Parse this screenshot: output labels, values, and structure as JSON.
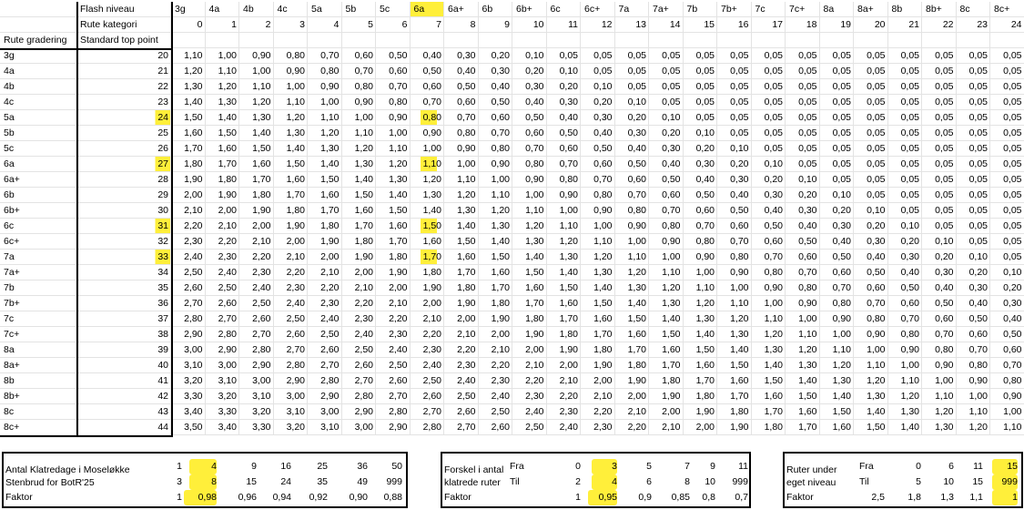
{
  "header": {
    "flash_label": "Flash niveau",
    "rute_kategori_label": "Rute kategori",
    "rute_gradering_label": "Rute gradering",
    "standard_top_label": "Standard top point",
    "grade_headers": [
      "3g",
      "4a",
      "4b",
      "4c",
      "5a",
      "5b",
      "5c",
      "6a",
      "6a+",
      "6b",
      "6b+",
      "6c",
      "6c+",
      "7a",
      "7a+",
      "7b",
      "7b+",
      "7c",
      "7c+",
      "8a",
      "8a+",
      "8b",
      "8b+",
      "8c",
      "8c+"
    ],
    "category_numbers": [
      "0",
      "1",
      "2",
      "3",
      "4",
      "5",
      "6",
      "7",
      "8",
      "9",
      "10",
      "11",
      "12",
      "13",
      "14",
      "15",
      "16",
      "17",
      "18",
      "19",
      "20",
      "21",
      "22",
      "23",
      "24"
    ]
  },
  "rows": [
    {
      "grade": "3g",
      "points": "20",
      "values": [
        "1,10",
        "1,00",
        "0,90",
        "0,80",
        "0,70",
        "0,60",
        "0,50",
        "0,40",
        "0,30",
        "0,20",
        "0,10",
        "0,05",
        "0,05",
        "0,05",
        "0,05",
        "0,05",
        "0,05",
        "0,05",
        "0,05",
        "0,05",
        "0,05",
        "0,05",
        "0,05",
        "0,05",
        "0,05"
      ]
    },
    {
      "grade": "4a",
      "points": "21",
      "values": [
        "1,20",
        "1,10",
        "1,00",
        "0,90",
        "0,80",
        "0,70",
        "0,60",
        "0,50",
        "0,40",
        "0,30",
        "0,20",
        "0,10",
        "0,05",
        "0,05",
        "0,05",
        "0,05",
        "0,05",
        "0,05",
        "0,05",
        "0,05",
        "0,05",
        "0,05",
        "0,05",
        "0,05",
        "0,05"
      ]
    },
    {
      "grade": "4b",
      "points": "22",
      "values": [
        "1,30",
        "1,20",
        "1,10",
        "1,00",
        "0,90",
        "0,80",
        "0,70",
        "0,60",
        "0,50",
        "0,40",
        "0,30",
        "0,20",
        "0,10",
        "0,05",
        "0,05",
        "0,05",
        "0,05",
        "0,05",
        "0,05",
        "0,05",
        "0,05",
        "0,05",
        "0,05",
        "0,05",
        "0,05"
      ]
    },
    {
      "grade": "4c",
      "points": "23",
      "values": [
        "1,40",
        "1,30",
        "1,20",
        "1,10",
        "1,00",
        "0,90",
        "0,80",
        "0,70",
        "0,60",
        "0,50",
        "0,40",
        "0,30",
        "0,20",
        "0,10",
        "0,05",
        "0,05",
        "0,05",
        "0,05",
        "0,05",
        "0,05",
        "0,05",
        "0,05",
        "0,05",
        "0,05",
        "0,05"
      ]
    },
    {
      "grade": "5a",
      "points": "24",
      "values": [
        "1,50",
        "1,40",
        "1,30",
        "1,20",
        "1,10",
        "1,00",
        "0,90",
        "0,80",
        "0,70",
        "0,60",
        "0,50",
        "0,40",
        "0,30",
        "0,20",
        "0,10",
        "0,05",
        "0,05",
        "0,05",
        "0,05",
        "0,05",
        "0,05",
        "0,05",
        "0,05",
        "0,05",
        "0,05"
      ]
    },
    {
      "grade": "5b",
      "points": "25",
      "values": [
        "1,60",
        "1,50",
        "1,40",
        "1,30",
        "1,20",
        "1,10",
        "1,00",
        "0,90",
        "0,80",
        "0,70",
        "0,60",
        "0,50",
        "0,40",
        "0,30",
        "0,20",
        "0,10",
        "0,05",
        "0,05",
        "0,05",
        "0,05",
        "0,05",
        "0,05",
        "0,05",
        "0,05",
        "0,05"
      ]
    },
    {
      "grade": "5c",
      "points": "26",
      "values": [
        "1,70",
        "1,60",
        "1,50",
        "1,40",
        "1,30",
        "1,20",
        "1,10",
        "1,00",
        "0,90",
        "0,80",
        "0,70",
        "0,60",
        "0,50",
        "0,40",
        "0,30",
        "0,20",
        "0,10",
        "0,05",
        "0,05",
        "0,05",
        "0,05",
        "0,05",
        "0,05",
        "0,05",
        "0,05"
      ]
    },
    {
      "grade": "6a",
      "points": "27",
      "values": [
        "1,80",
        "1,70",
        "1,60",
        "1,50",
        "1,40",
        "1,30",
        "1,20",
        "1,10",
        "1,00",
        "0,90",
        "0,80",
        "0,70",
        "0,60",
        "0,50",
        "0,40",
        "0,30",
        "0,20",
        "0,10",
        "0,05",
        "0,05",
        "0,05",
        "0,05",
        "0,05",
        "0,05",
        "0,05"
      ]
    },
    {
      "grade": "6a+",
      "points": "28",
      "values": [
        "1,90",
        "1,80",
        "1,70",
        "1,60",
        "1,50",
        "1,40",
        "1,30",
        "1,20",
        "1,10",
        "1,00",
        "0,90",
        "0,80",
        "0,70",
        "0,60",
        "0,50",
        "0,40",
        "0,30",
        "0,20",
        "0,10",
        "0,05",
        "0,05",
        "0,05",
        "0,05",
        "0,05",
        "0,05"
      ]
    },
    {
      "grade": "6b",
      "points": "29",
      "values": [
        "2,00",
        "1,90",
        "1,80",
        "1,70",
        "1,60",
        "1,50",
        "1,40",
        "1,30",
        "1,20",
        "1,10",
        "1,00",
        "0,90",
        "0,80",
        "0,70",
        "0,60",
        "0,50",
        "0,40",
        "0,30",
        "0,20",
        "0,10",
        "0,05",
        "0,05",
        "0,05",
        "0,05",
        "0,05"
      ]
    },
    {
      "grade": "6b+",
      "points": "30",
      "values": [
        "2,10",
        "2,00",
        "1,90",
        "1,80",
        "1,70",
        "1,60",
        "1,50",
        "1,40",
        "1,30",
        "1,20",
        "1,10",
        "1,00",
        "0,90",
        "0,80",
        "0,70",
        "0,60",
        "0,50",
        "0,40",
        "0,30",
        "0,20",
        "0,10",
        "0,05",
        "0,05",
        "0,05",
        "0,05"
      ]
    },
    {
      "grade": "6c",
      "points": "31",
      "values": [
        "2,20",
        "2,10",
        "2,00",
        "1,90",
        "1,80",
        "1,70",
        "1,60",
        "1,50",
        "1,40",
        "1,30",
        "1,20",
        "1,10",
        "1,00",
        "0,90",
        "0,80",
        "0,70",
        "0,60",
        "0,50",
        "0,40",
        "0,30",
        "0,20",
        "0,10",
        "0,05",
        "0,05",
        "0,05"
      ]
    },
    {
      "grade": "6c+",
      "points": "32",
      "values": [
        "2,30",
        "2,20",
        "2,10",
        "2,00",
        "1,90",
        "1,80",
        "1,70",
        "1,60",
        "1,50",
        "1,40",
        "1,30",
        "1,20",
        "1,10",
        "1,00",
        "0,90",
        "0,80",
        "0,70",
        "0,60",
        "0,50",
        "0,40",
        "0,30",
        "0,20",
        "0,10",
        "0,05",
        "0,05"
      ]
    },
    {
      "grade": "7a",
      "points": "33",
      "values": [
        "2,40",
        "2,30",
        "2,20",
        "2,10",
        "2,00",
        "1,90",
        "1,80",
        "1,70",
        "1,60",
        "1,50",
        "1,40",
        "1,30",
        "1,20",
        "1,10",
        "1,00",
        "0,90",
        "0,80",
        "0,70",
        "0,60",
        "0,50",
        "0,40",
        "0,30",
        "0,20",
        "0,10",
        "0,05"
      ]
    },
    {
      "grade": "7a+",
      "points": "34",
      "values": [
        "2,50",
        "2,40",
        "2,30",
        "2,20",
        "2,10",
        "2,00",
        "1,90",
        "1,80",
        "1,70",
        "1,60",
        "1,50",
        "1,40",
        "1,30",
        "1,20",
        "1,10",
        "1,00",
        "0,90",
        "0,80",
        "0,70",
        "0,60",
        "0,50",
        "0,40",
        "0,30",
        "0,20",
        "0,10"
      ]
    },
    {
      "grade": "7b",
      "points": "35",
      "values": [
        "2,60",
        "2,50",
        "2,40",
        "2,30",
        "2,20",
        "2,10",
        "2,00",
        "1,90",
        "1,80",
        "1,70",
        "1,60",
        "1,50",
        "1,40",
        "1,30",
        "1,20",
        "1,10",
        "1,00",
        "0,90",
        "0,80",
        "0,70",
        "0,60",
        "0,50",
        "0,40",
        "0,30",
        "0,20"
      ]
    },
    {
      "grade": "7b+",
      "points": "36",
      "values": [
        "2,70",
        "2,60",
        "2,50",
        "2,40",
        "2,30",
        "2,20",
        "2,10",
        "2,00",
        "1,90",
        "1,80",
        "1,70",
        "1,60",
        "1,50",
        "1,40",
        "1,30",
        "1,20",
        "1,10",
        "1,00",
        "0,90",
        "0,80",
        "0,70",
        "0,60",
        "0,50",
        "0,40",
        "0,30"
      ]
    },
    {
      "grade": "7c",
      "points": "37",
      "values": [
        "2,80",
        "2,70",
        "2,60",
        "2,50",
        "2,40",
        "2,30",
        "2,20",
        "2,10",
        "2,00",
        "1,90",
        "1,80",
        "1,70",
        "1,60",
        "1,50",
        "1,40",
        "1,30",
        "1,20",
        "1,10",
        "1,00",
        "0,90",
        "0,80",
        "0,70",
        "0,60",
        "0,50",
        "0,40"
      ]
    },
    {
      "grade": "7c+",
      "points": "38",
      "values": [
        "2,90",
        "2,80",
        "2,70",
        "2,60",
        "2,50",
        "2,40",
        "2,30",
        "2,20",
        "2,10",
        "2,00",
        "1,90",
        "1,80",
        "1,70",
        "1,60",
        "1,50",
        "1,40",
        "1,30",
        "1,20",
        "1,10",
        "1,00",
        "0,90",
        "0,80",
        "0,70",
        "0,60",
        "0,50"
      ]
    },
    {
      "grade": "8a",
      "points": "39",
      "values": [
        "3,00",
        "2,90",
        "2,80",
        "2,70",
        "2,60",
        "2,50",
        "2,40",
        "2,30",
        "2,20",
        "2,10",
        "2,00",
        "1,90",
        "1,80",
        "1,70",
        "1,60",
        "1,50",
        "1,40",
        "1,30",
        "1,20",
        "1,10",
        "1,00",
        "0,90",
        "0,80",
        "0,70",
        "0,60"
      ]
    },
    {
      "grade": "8a+",
      "points": "40",
      "values": [
        "3,10",
        "3,00",
        "2,90",
        "2,80",
        "2,70",
        "2,60",
        "2,50",
        "2,40",
        "2,30",
        "2,20",
        "2,10",
        "2,00",
        "1,90",
        "1,80",
        "1,70",
        "1,60",
        "1,50",
        "1,40",
        "1,30",
        "1,20",
        "1,10",
        "1,00",
        "0,90",
        "0,80",
        "0,70"
      ]
    },
    {
      "grade": "8b",
      "points": "41",
      "values": [
        "3,20",
        "3,10",
        "3,00",
        "2,90",
        "2,80",
        "2,70",
        "2,60",
        "2,50",
        "2,40",
        "2,30",
        "2,20",
        "2,10",
        "2,00",
        "1,90",
        "1,80",
        "1,70",
        "1,60",
        "1,50",
        "1,40",
        "1,30",
        "1,20",
        "1,10",
        "1,00",
        "0,90",
        "0,80"
      ]
    },
    {
      "grade": "8b+",
      "points": "42",
      "values": [
        "3,30",
        "3,20",
        "3,10",
        "3,00",
        "2,90",
        "2,80",
        "2,70",
        "2,60",
        "2,50",
        "2,40",
        "2,30",
        "2,20",
        "2,10",
        "2,00",
        "1,90",
        "1,80",
        "1,70",
        "1,60",
        "1,50",
        "1,40",
        "1,30",
        "1,20",
        "1,10",
        "1,00",
        "0,90"
      ]
    },
    {
      "grade": "8c",
      "points": "43",
      "values": [
        "3,40",
        "3,30",
        "3,20",
        "3,10",
        "3,00",
        "2,90",
        "2,80",
        "2,70",
        "2,60",
        "2,50",
        "2,40",
        "2,30",
        "2,20",
        "2,10",
        "2,00",
        "1,90",
        "1,80",
        "1,70",
        "1,60",
        "1,50",
        "1,40",
        "1,30",
        "1,20",
        "1,10",
        "1,00"
      ]
    },
    {
      "grade": "8c+",
      "points": "44",
      "values": [
        "3,50",
        "3,40",
        "3,30",
        "3,20",
        "3,10",
        "3,00",
        "2,90",
        "2,80",
        "2,70",
        "2,60",
        "2,50",
        "2,40",
        "2,30",
        "2,20",
        "2,10",
        "2,00",
        "1,90",
        "1,80",
        "1,70",
        "1,60",
        "1,50",
        "1,40",
        "1,30",
        "1,20",
        "1,10"
      ]
    }
  ],
  "highlights": {
    "color": "#ffef3a",
    "grade_header_index": 7,
    "highlighted_points_rows": [
      "5a",
      "6a",
      "6c",
      "7a"
    ],
    "highlighted_value_cells": [
      {
        "row": "5a",
        "col": 7
      },
      {
        "row": "6a",
        "col": 7
      },
      {
        "row": "6c",
        "col": 7
      },
      {
        "row": "7a",
        "col": 7
      }
    ]
  },
  "bottom_left": {
    "label_line1": "Antal Klatredage i Moseløkke",
    "label_line2": "Stenbrud for BotR'25",
    "faktor_label": "Faktor",
    "row1": [
      "1",
      "4",
      "9",
      "16",
      "25",
      "36",
      "50"
    ],
    "row2": [
      "3",
      "8",
      "15",
      "24",
      "35",
      "49",
      "999"
    ],
    "faktor": [
      "1",
      "0,98",
      "0,96",
      "0,94",
      "0,92",
      "0,90",
      "0,88"
    ]
  },
  "bottom_mid": {
    "label_line1": "Forskel i antal",
    "label_line2": "klatrede ruter",
    "fra_label": "Fra",
    "til_label": "Til",
    "faktor_label": "Faktor",
    "fra": [
      "0",
      "3",
      "5",
      "7",
      "9",
      "11"
    ],
    "til": [
      "2",
      "4",
      "6",
      "8",
      "10",
      "999"
    ],
    "faktor": [
      "1",
      "0,95",
      "0,9",
      "0,85",
      "0,8",
      "0,7"
    ]
  },
  "bottom_right": {
    "label_line1": "Ruter under",
    "label_line2": "eget niveau",
    "fra_label": "Fra",
    "til_label": "Til",
    "faktor_label": "Faktor",
    "fra": [
      "0",
      "6",
      "11",
      "15"
    ],
    "til": [
      "5",
      "10",
      "15",
      "999"
    ],
    "faktor": [
      "2,5",
      "1,8",
      "1,3",
      "1,1",
      "1"
    ]
  }
}
